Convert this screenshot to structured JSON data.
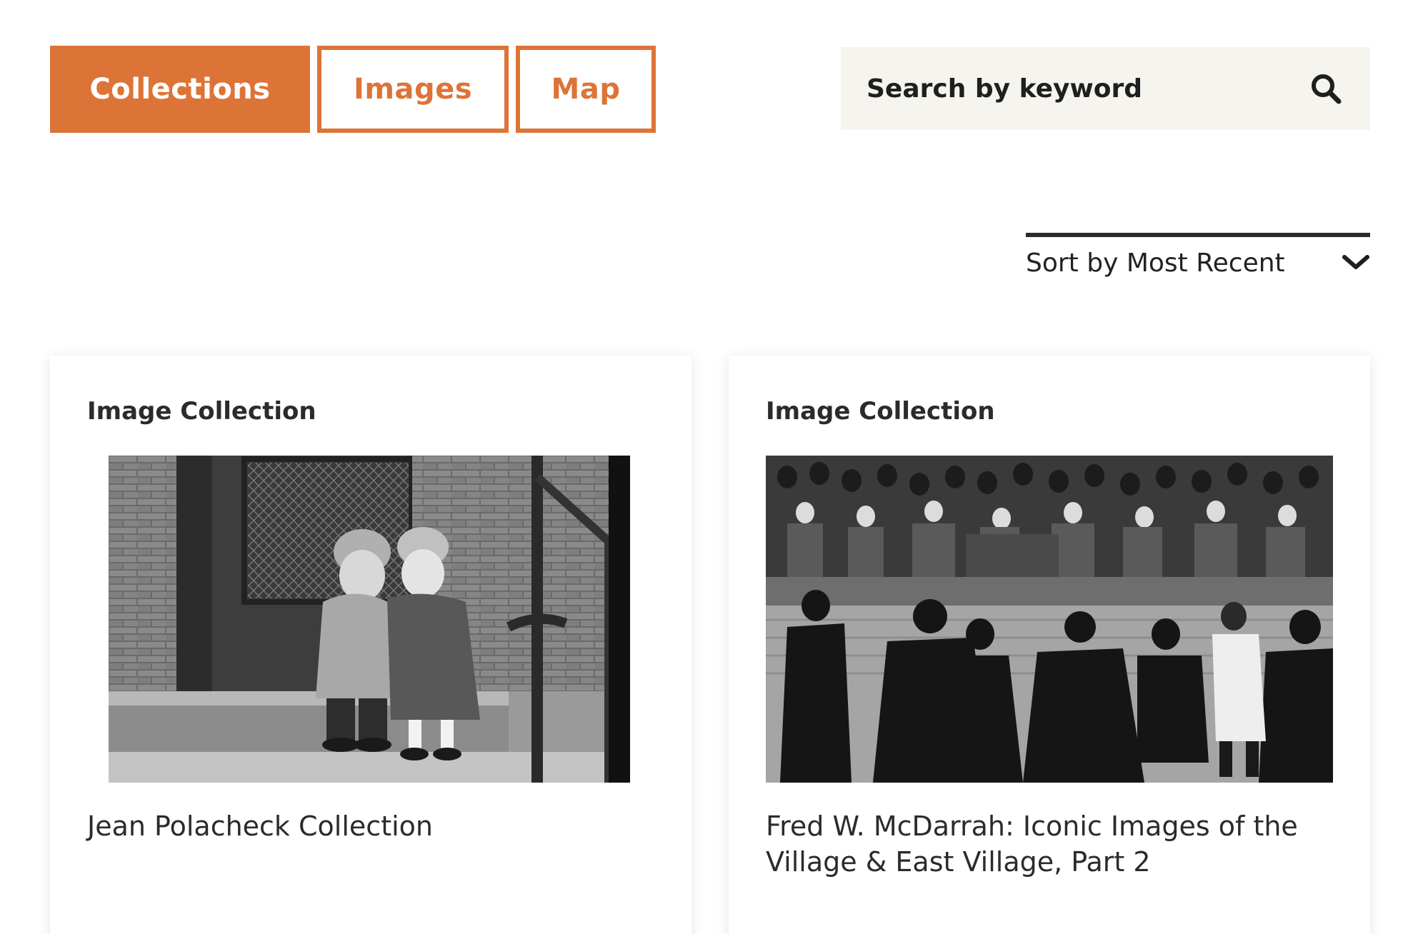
{
  "tabs": [
    {
      "label": "Collections",
      "active": true
    },
    {
      "label": "Images",
      "active": false
    },
    {
      "label": "Map",
      "active": false
    }
  ],
  "search": {
    "placeholder": "Search by keyword",
    "icon": "search-icon"
  },
  "sort": {
    "label": "Sort by Most Recent",
    "icon": "chevron-down-icon"
  },
  "cards": [
    {
      "type": "Image Collection",
      "title": "Jean Polacheck Collection"
    },
    {
      "type": "Image Collection",
      "title": "Fred W. McDarrah: Iconic Images of the Village & East Village, Part 2"
    }
  ],
  "colors": {
    "accent": "#DD7437",
    "search_bg": "#F6F4EF",
    "text": "#222222"
  }
}
